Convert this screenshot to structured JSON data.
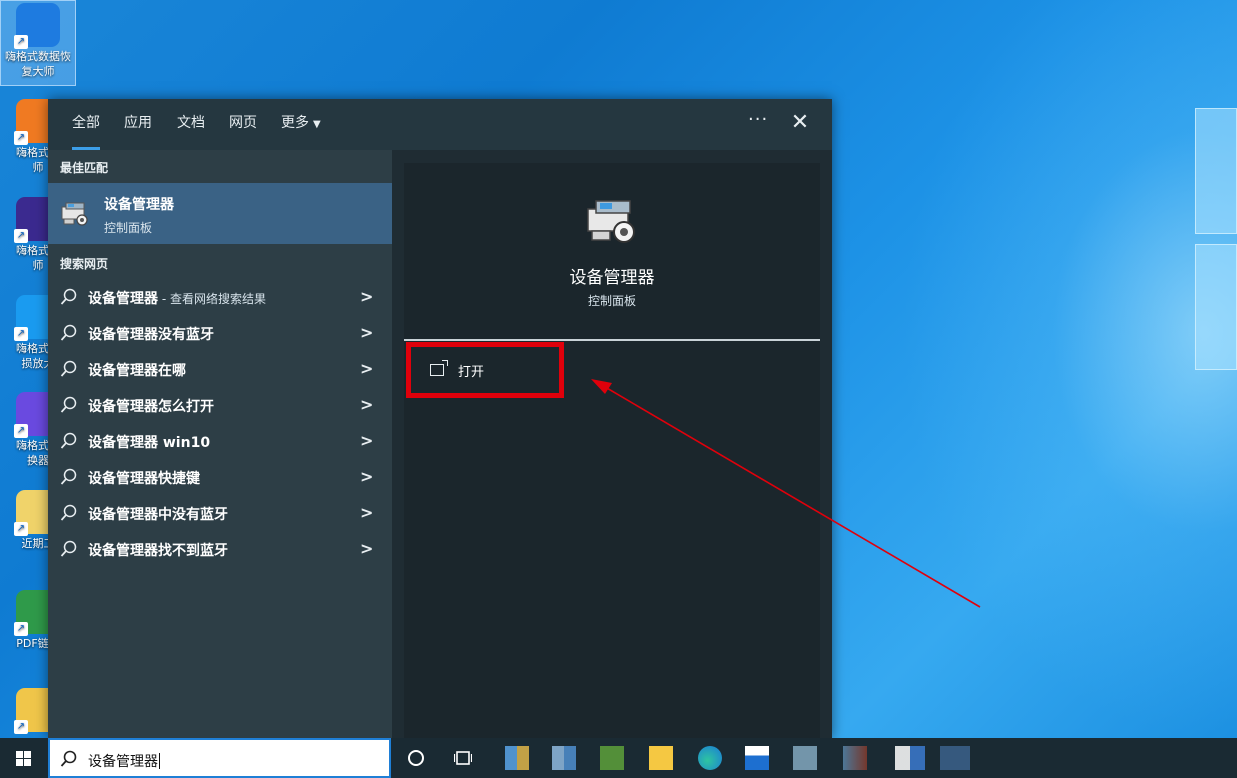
{
  "desktop": {
    "icons": [
      {
        "label": "嗨格式数据恢\n复大师",
        "color": "#1e7be0",
        "selected": true
      },
      {
        "label": "嗨格式压\n师",
        "color": "#f07a22"
      },
      {
        "label": "嗨格式剪\n师",
        "color": "#3b2a8f"
      },
      {
        "label": "嗨格式图\n损放大",
        "color": "#1a9bf0"
      },
      {
        "label": "嗨格式视\n换器",
        "color": "#6a4ae0"
      },
      {
        "label": "近期工",
        "color": "#f0d36a"
      },
      {
        "label": "PDF链接",
        "color": "#2f9a4a"
      },
      {
        "label": "",
        "color": "#f0c64a"
      }
    ]
  },
  "search_panel": {
    "tabs": [
      "全部",
      "应用",
      "文档",
      "网页",
      "更多"
    ],
    "more_dots": "···",
    "close": "✕",
    "best_match_heading": "最佳匹配",
    "best_match": {
      "title": "设备管理器",
      "subtitle": "控制面板"
    },
    "web_heading": "搜索网页",
    "web_results": [
      {
        "text": "设备管理器",
        "suffix": " - 查看网络搜索结果"
      },
      {
        "text": "设备管理器没有蓝牙",
        "suffix": ""
      },
      {
        "text": "设备管理器在哪",
        "suffix": ""
      },
      {
        "text": "设备管理器怎么打开",
        "suffix": ""
      },
      {
        "text": "设备管理器 win10",
        "suffix": ""
      },
      {
        "text": "设备管理器快捷键",
        "suffix": ""
      },
      {
        "text": "设备管理器中没有蓝牙",
        "suffix": ""
      },
      {
        "text": "设备管理器找不到蓝牙",
        "suffix": ""
      }
    ],
    "preview": {
      "title": "设备管理器",
      "subtitle": "控制面板",
      "action_open": "打开"
    }
  },
  "taskbar": {
    "search_value": "设备管理器"
  },
  "colors": {
    "accent": "#3c9ee8",
    "highlight_box": "#e0000b",
    "best_match_bg": "#3a6285"
  }
}
